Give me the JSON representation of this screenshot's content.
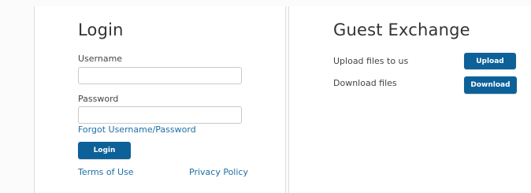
{
  "login": {
    "title": "Login",
    "username_label": "Username",
    "username_value": "",
    "password_label": "Password",
    "password_value": "",
    "forgot_link": "Forgot Username/Password",
    "login_button": "Login",
    "terms_link": "Terms of Use",
    "privacy_link": "Privacy Policy"
  },
  "guest": {
    "title": "Guest Exchange",
    "upload_text": "Upload files to us",
    "upload_button": "Upload",
    "download_text": "Download files",
    "download_button": "Download"
  },
  "colors": {
    "button": "#0d6199",
    "link": "#1d6fa5",
    "heading": "#333333"
  }
}
